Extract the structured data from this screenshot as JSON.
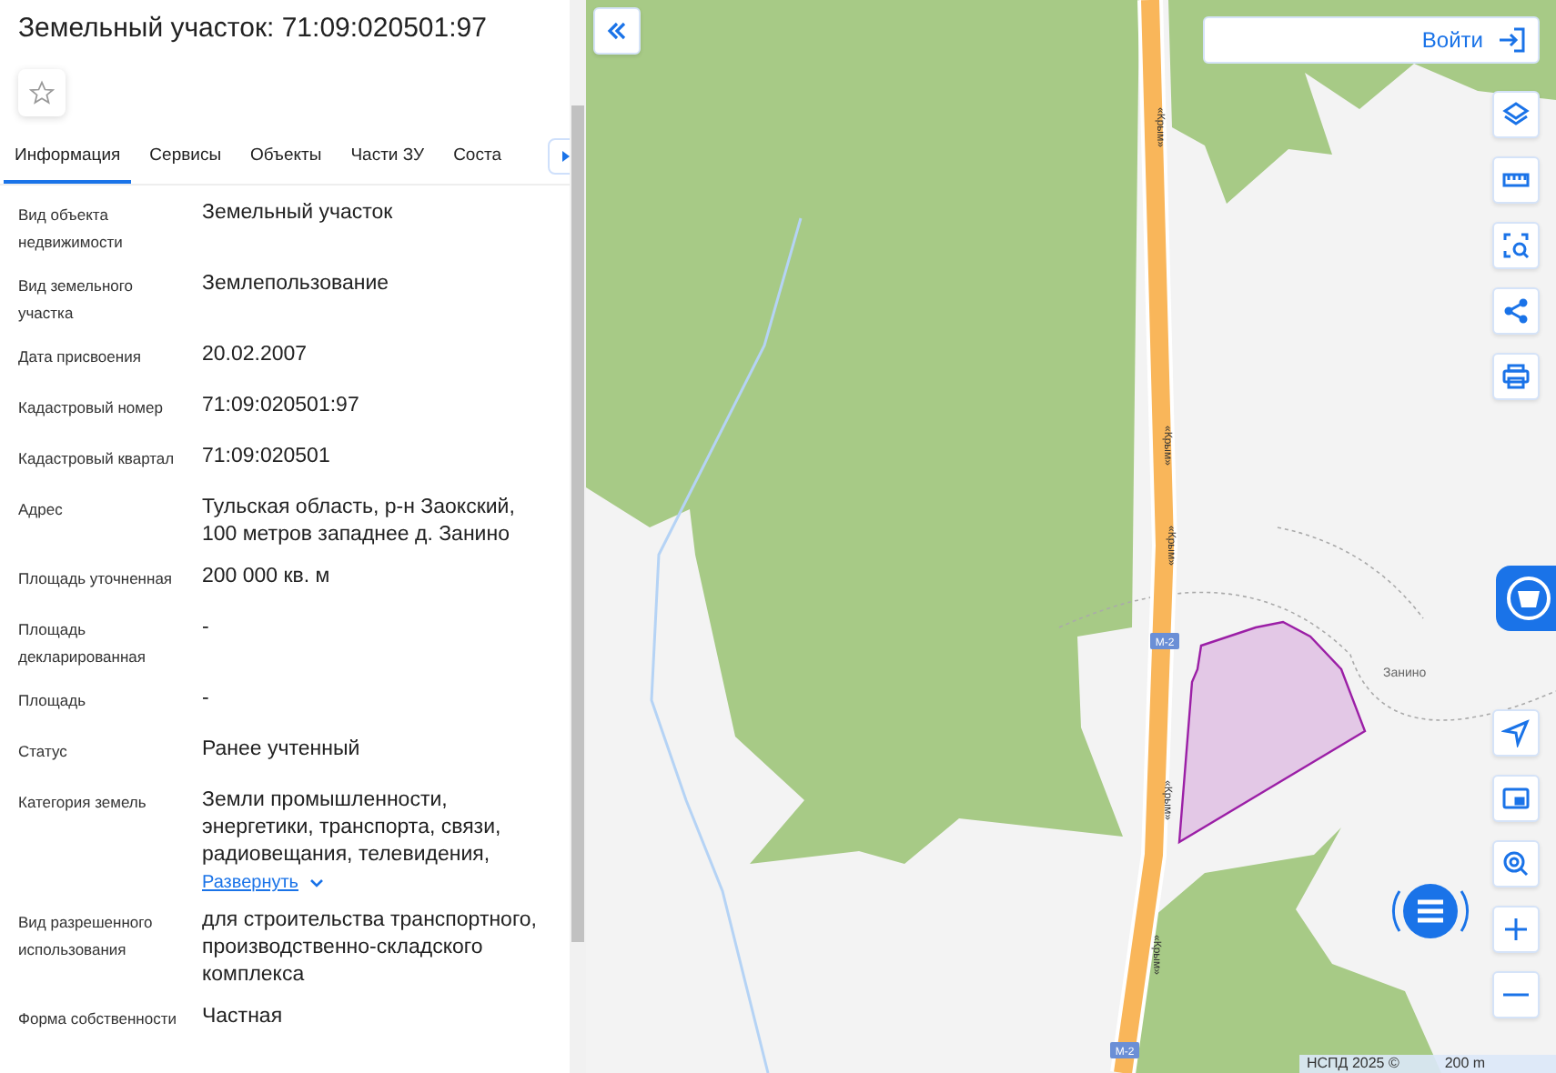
{
  "panel": {
    "title": "Земельный участок: 71:09:020501:97",
    "favorite": false,
    "tabs": [
      {
        "label": "Информация",
        "selected": true
      },
      {
        "label": "Сервисы",
        "selected": false
      },
      {
        "label": "Объекты",
        "selected": false
      },
      {
        "label": "Части ЗУ",
        "selected": false
      },
      {
        "label": "Соста",
        "selected": false
      }
    ],
    "properties": [
      {
        "label": "Вид объекта недвижимости",
        "value": "Земельный участок"
      },
      {
        "label": "Вид земельного участка",
        "value": "Землепользование"
      },
      {
        "label": "Дата присвоения",
        "value": "20.02.2007"
      },
      {
        "label": "Кадастровый номер",
        "value": "71:09:020501:97"
      },
      {
        "label": "Кадастровый квартал",
        "value": "71:09:020501"
      },
      {
        "label": "Адрес",
        "value": "Тульская область, р-н Заокский, 100 метров западнее д. Занино"
      },
      {
        "label": "Площадь уточненная",
        "value": "200 000 кв. м"
      },
      {
        "label": "Площадь декларированная",
        "value": "-"
      },
      {
        "label": "Площадь",
        "value": "-"
      },
      {
        "label": "Статус",
        "value": "Ранее учтенный"
      },
      {
        "label": "Категория земель",
        "value": "Земли промышленности, энергетики, транспорта, связи, радиовещания, телевидения,",
        "expand_link": "Развернуть"
      },
      {
        "label": "Вид разрешенного использования",
        "value": "для строительства транспортного, производственно-складского комплекса"
      },
      {
        "label": "Форма собственности",
        "value": "Частная"
      }
    ]
  },
  "map": {
    "login_button": "Войти",
    "road_labels": [
      "«Крым»",
      "«Крым»",
      "«Крым»",
      "«Крым»",
      "«Крым»"
    ],
    "route_badges": [
      "М-2",
      "М-2"
    ],
    "place_label": "Занино",
    "attribution": "НСПД 2025 ©",
    "scale": "200 m"
  }
}
